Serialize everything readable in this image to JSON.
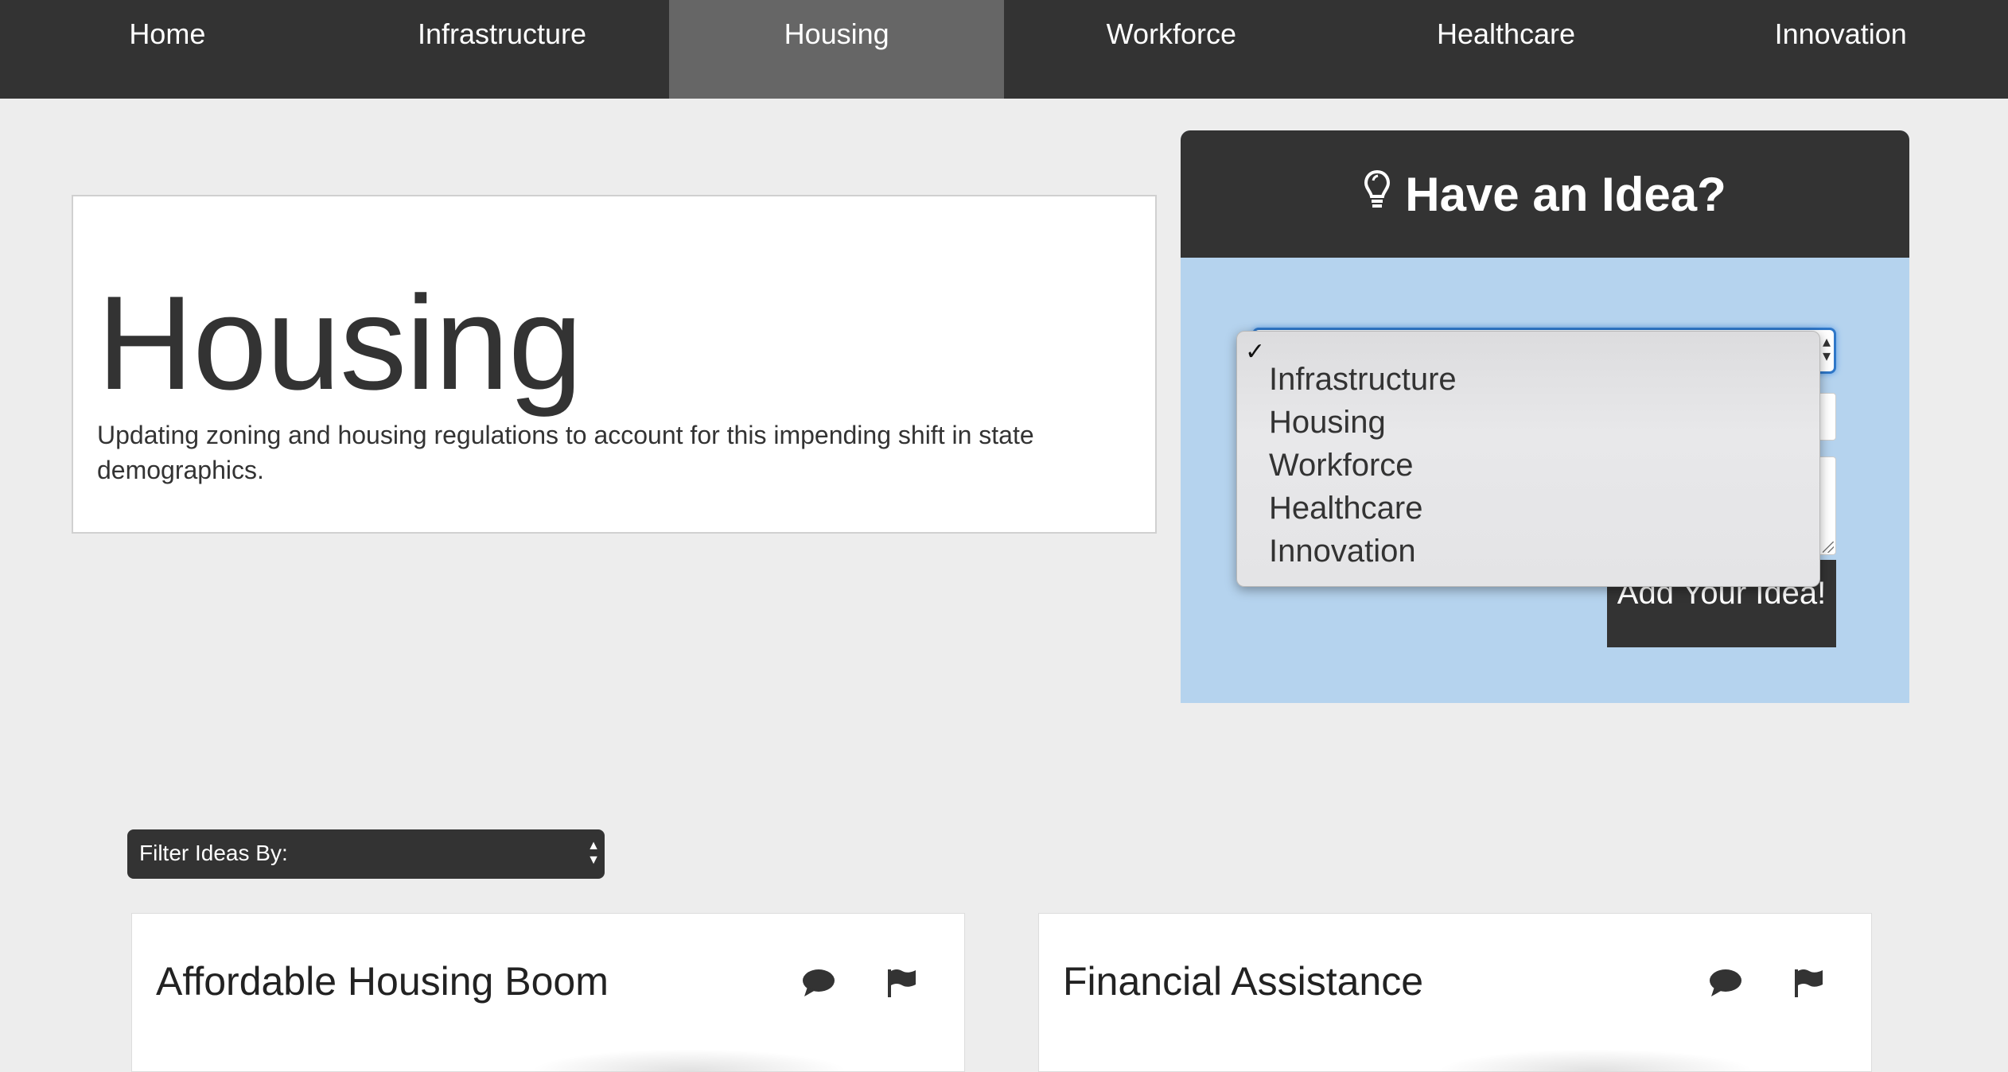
{
  "nav": {
    "items": [
      {
        "label": "Home",
        "active": false
      },
      {
        "label": "Infrastructure",
        "active": false
      },
      {
        "label": "Housing",
        "active": true
      },
      {
        "label": "Workforce",
        "active": false
      },
      {
        "label": "Healthcare",
        "active": false
      },
      {
        "label": "Innovation",
        "active": false
      }
    ]
  },
  "hero": {
    "title": "Housing",
    "description": "Updating zoning and housing regulations to account for this impending shift in state demographics."
  },
  "idea_panel": {
    "heading": "Have an Idea?",
    "heading_icon": "lightbulb-icon",
    "submit_label": "Add Your Idea!",
    "category_dropdown": {
      "selected": "",
      "options": [
        "",
        "Infrastructure",
        "Housing",
        "Workforce",
        "Healthcare",
        "Innovation"
      ]
    }
  },
  "filter": {
    "label": "Filter Ideas By:"
  },
  "cards": [
    {
      "title": "Affordable Housing Boom",
      "icons": [
        "comment-icon",
        "flag-icon"
      ]
    },
    {
      "title": "Financial Assistance",
      "icons": [
        "comment-icon",
        "flag-icon"
      ]
    }
  ],
  "colors": {
    "nav_bg": "#333333",
    "nav_active": "#666666",
    "page_bg": "#ededed",
    "idea_panel_bg": "#b5d3ee",
    "dark": "#333333"
  }
}
